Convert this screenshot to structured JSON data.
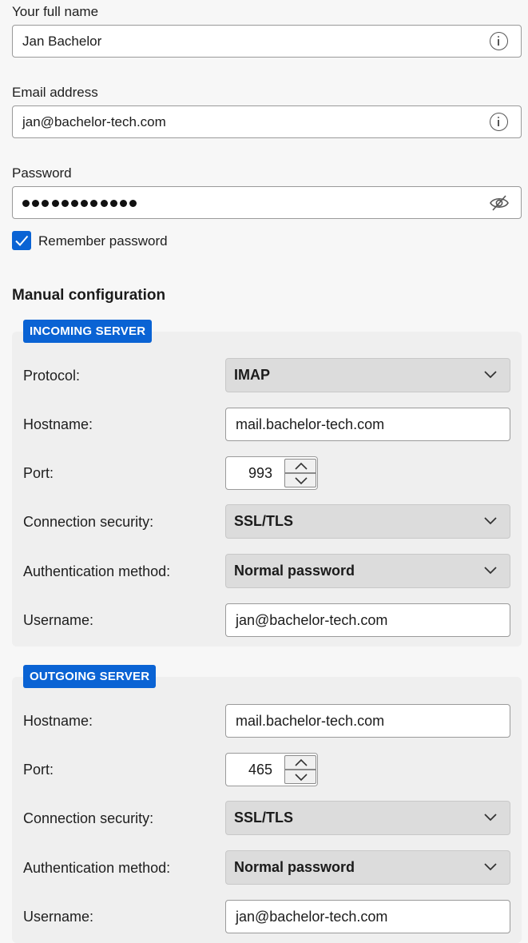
{
  "account": {
    "name_label": "Your full name",
    "name_value": "Jan Bachelor",
    "email_label": "Email address",
    "email_value": "jan@bachelor-tech.com",
    "password_label": "Password",
    "password_dot_count": 12,
    "remember_label": "Remember password",
    "remember_checked": true
  },
  "manual": {
    "title": "Manual configuration",
    "incoming": {
      "tag": "INCOMING SERVER",
      "protocol_label": "Protocol:",
      "protocol_value": "IMAP",
      "hostname_label": "Hostname:",
      "hostname_value": "mail.bachelor-tech.com",
      "port_label": "Port:",
      "port_value": "993",
      "security_label": "Connection security:",
      "security_value": "SSL/TLS",
      "auth_label": "Authentication method:",
      "auth_value": "Normal password",
      "username_label": "Username:",
      "username_value": "jan@bachelor-tech.com"
    },
    "outgoing": {
      "tag": "OUTGOING SERVER",
      "hostname_label": "Hostname:",
      "hostname_value": "mail.bachelor-tech.com",
      "port_label": "Port:",
      "port_value": "465",
      "security_label": "Connection security:",
      "security_value": "SSL/TLS",
      "auth_label": "Authentication method:",
      "auth_value": "Normal password",
      "username_label": "Username:",
      "username_value": "jan@bachelor-tech.com"
    }
  },
  "icons": {
    "info": "info-icon",
    "eye": "eye-hidden-icon",
    "chevron": "chevron-down-icon",
    "spin_up": "chevron-up-icon",
    "spin_down": "chevron-down-icon",
    "check": "checkmark-icon"
  },
  "colors": {
    "accent": "#0a63d4",
    "page_bg": "#f7f7f7",
    "group_bg": "#efefef",
    "select_bg": "#dcdcdc"
  }
}
